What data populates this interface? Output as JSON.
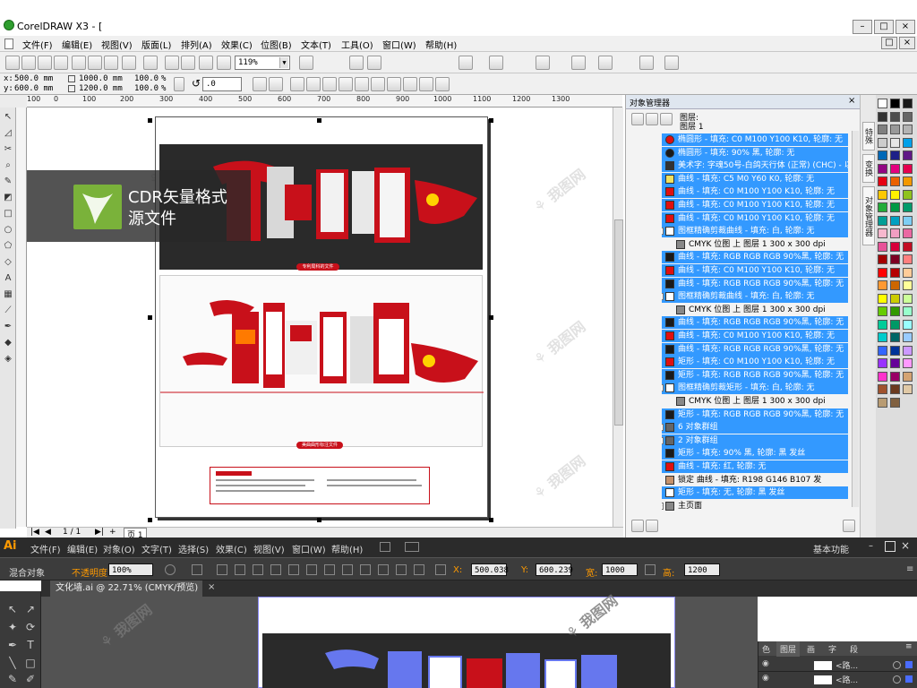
{
  "corel": {
    "title": "CorelDRAW X3 - [",
    "menu": [
      "文件(F)",
      "编辑(E)",
      "视图(V)",
      "版面(L)",
      "排列(A)",
      "效果(C)",
      "位图(B)",
      "文本(T)",
      "工具(O)",
      "窗口(W)",
      "帮助(H)"
    ],
    "zoom": "119%",
    "x_label": "x:",
    "x_value": "500.0 mm",
    "y_label": "y:",
    "y_value": "600.0 mm",
    "w_value": "1000.0 mm",
    "h_value": "1200.0 mm",
    "scale_x": "100.0",
    "scale_y": "100.0",
    "pct": "%",
    "angle": ".0",
    "ruler_h": [
      "100",
      "0",
      "100",
      "200",
      "300",
      "400",
      "500",
      "600",
      "700",
      "800",
      "900",
      "1000",
      "1100",
      "1200",
      "1300"
    ],
    "page_nav": "1 / 1",
    "page_tab": "页 1",
    "page_labels": {
      "top": "专利局科的文件",
      "bottom": "美曲曲形标注文件"
    }
  },
  "overlay": {
    "line1": "CDR矢量格式",
    "line2": "源文件"
  },
  "object_manager": {
    "title": "对象管理器",
    "layer_header": "图层:",
    "layer_name": "图层 1",
    "rows": [
      {
        "text": "椭圆形 - 填充: C0 M100 Y100 K10, 轮廓: 无",
        "selected": true,
        "icon": "red-ellipse-icon",
        "color": "#e01010"
      },
      {
        "text": "椭圆形 - 填充: 90% 黑, 轮廓: 无",
        "selected": true,
        "icon": "black-ellipse-icon",
        "color": "#1a1a1a"
      },
      {
        "text": "美术字: 字魂50号-白鸽天行体 (正常) (CHC) - 以",
        "selected": true,
        "icon": "text-a-icon",
        "color": "#333333"
      },
      {
        "text": "曲线 - 填充: C5 M0 Y60 K0, 轮廓: 无",
        "selected": true,
        "icon": "curve-icon",
        "color": "#f0e060"
      },
      {
        "text": "曲线 - 填充: C0 M100 Y100 K10, 轮廓: 无",
        "selected": true,
        "icon": "curve-icon",
        "color": "#e01010"
      },
      {
        "text": "曲线 - 填充: C0 M100 Y100 K10, 轮廓: 无",
        "selected": true,
        "icon": "curve-icon",
        "color": "#e01010"
      },
      {
        "text": "曲线 - 填充: C0 M100 Y100 K10, 轮廓: 无",
        "selected": true,
        "icon": "curve-icon",
        "color": "#e01010"
      },
      {
        "text": "图框精确剪裁曲线 - 填充: 白, 轮廓: 无",
        "selected": true,
        "icon": "powerclip-icon",
        "color": "#ffffff",
        "tree": "-"
      },
      {
        "text": "CMYK 位图 上 图层 1 300 x 300 dpi",
        "selected": false,
        "icon": "bitmap-icon",
        "color": "#888888",
        "indent": true
      },
      {
        "text": "曲线 - 填充: RGB RGB RGB 90%黑, 轮廓: 无",
        "selected": true,
        "icon": "curve-icon",
        "color": "#1a1a1a"
      },
      {
        "text": "曲线 - 填充: C0 M100 Y100 K10, 轮廓: 无",
        "selected": true,
        "icon": "curve-icon",
        "color": "#e01010"
      },
      {
        "text": "曲线 - 填充: RGB RGB RGB 90%黑, 轮廓: 无",
        "selected": true,
        "icon": "curve-icon",
        "color": "#1a1a1a"
      },
      {
        "text": "图框精确剪裁曲线 - 填充: 白, 轮廓: 无",
        "selected": true,
        "icon": "powerclip-icon",
        "color": "#ffffff",
        "tree": "-"
      },
      {
        "text": "CMYK 位图 上 图层 1 300 x 300 dpi",
        "selected": false,
        "icon": "bitmap-icon",
        "color": "#888888",
        "indent": true
      },
      {
        "text": "曲线 - 填充: RGB RGB RGB 90%黑, 轮廓: 无",
        "selected": true,
        "icon": "curve-icon",
        "color": "#1a1a1a"
      },
      {
        "text": "曲线 - 填充: C0 M100 Y100 K10, 轮廓: 无",
        "selected": true,
        "icon": "curve-icon",
        "color": "#e01010"
      },
      {
        "text": "曲线 - 填充: RGB RGB RGB 90%黑, 轮廓: 无",
        "selected": true,
        "icon": "curve-icon",
        "color": "#1a1a1a"
      },
      {
        "text": "矩形 - 填充: C0 M100 Y100 K10, 轮廓: 无",
        "selected": true,
        "icon": "rect-icon",
        "color": "#e01010"
      },
      {
        "text": "矩形 - 填充: RGB RGB RGB 90%黑, 轮廓: 无",
        "selected": true,
        "icon": "rect-icon",
        "color": "#1a1a1a"
      },
      {
        "text": "图框精确剪裁矩形 - 填充: 白, 轮廓: 无",
        "selected": true,
        "icon": "rect-icon",
        "color": "#ffffff",
        "tree": "-"
      },
      {
        "text": "CMYK 位图 上 图层 1 300 x 300 dpi",
        "selected": false,
        "icon": "bitmap-icon",
        "color": "#888888",
        "indent": true
      },
      {
        "text": "矩形 - 填充: RGB RGB RGB 90%黑, 轮廓: 无",
        "selected": true,
        "icon": "rect-icon",
        "color": "#1a1a1a"
      },
      {
        "text": "6 对象群组",
        "selected": true,
        "icon": "group-icon",
        "color": "#666666",
        "tree": "+"
      },
      {
        "text": "2 对象群组",
        "selected": true,
        "icon": "group-icon",
        "color": "#666666",
        "tree": "+"
      },
      {
        "text": "矩形 - 填充: 90% 黑, 轮廓: 黑 发丝",
        "selected": true,
        "icon": "rect-icon",
        "color": "#1a1a1a"
      },
      {
        "text": "曲线 - 填充: 红, 轮廓: 无",
        "selected": true,
        "icon": "curve-icon",
        "color": "#e01010"
      },
      {
        "text": "锁定 曲线 - 填充: R198 G146 B107 发",
        "selected": false,
        "icon": "lock-icon",
        "color": "#c6926b"
      },
      {
        "text": "矩形 - 填充: 无, 轮廓: 黑 发丝",
        "selected": true,
        "icon": "rect-icon",
        "color": "#ffffff"
      },
      {
        "text": "主页面",
        "selected": false,
        "icon": "page-icon",
        "color": "#888888",
        "tree": "+"
      }
    ]
  },
  "side_tabs": [
    "特殊",
    "变换",
    "对象管理器"
  ],
  "palette": [
    "#ffffff",
    "#000000",
    "#1a1a1a",
    "#333333",
    "#4d4d4d",
    "#666666",
    "#808080",
    "#999999",
    "#b3b3b3",
    "#cccccc",
    "#e6e6e6",
    "#00a0e9",
    "#0068b7",
    "#1d2088",
    "#601986",
    "#920783",
    "#e4007f",
    "#e5004f",
    "#e60012",
    "#eb6100",
    "#f39800",
    "#fcc800",
    "#fff100",
    "#8fc31f",
    "#22ac38",
    "#009944",
    "#009b6b",
    "#009e96",
    "#00a0c1",
    "#7ecef4",
    "#f7b8ce",
    "#f19ec2",
    "#ea68a2",
    "#e85298",
    "#d7003a",
    "#c30d23",
    "#a40000",
    "#7d0022",
    "#ff7f7f",
    "#ff0000",
    "#b50000",
    "#ffcc99",
    "#ff9933",
    "#cc6600",
    "#ffff99",
    "#ffff00",
    "#cccc00",
    "#ccff99",
    "#66cc00",
    "#339900",
    "#99ffcc",
    "#00cc99",
    "#009966",
    "#99ffff",
    "#00cccc",
    "#006666",
    "#99ccff",
    "#3366ff",
    "#003399",
    "#cc99ff",
    "#9933ff",
    "#660099",
    "#ff99ff",
    "#ff33cc",
    "#990066",
    "#d4a373",
    "#a0522d",
    "#6b3a1f",
    "#e0c9a6",
    "#b89b72",
    "#806040"
  ],
  "illustrator": {
    "logo": "Ai",
    "menu": [
      "文件(F)",
      "编辑(E)",
      "对象(O)",
      "文字(T)",
      "选择(S)",
      "效果(C)",
      "视图(V)",
      "窗口(W)",
      "帮助(H)"
    ],
    "workspace": "基本功能",
    "ctrl_label": "混合对象",
    "opacity_label": "不透明度:",
    "opacity_value": "100%",
    "x_label": "X:",
    "x_value": "500.038",
    "y_label": "Y:",
    "y_value": "600.239",
    "w_label": "宽:",
    "w_value": "1000 mm",
    "h_label": "高:",
    "h_value": "1200 mm",
    "tab_label": "文化墙.ai @ 22.71% (CMYK/预览)",
    "layers_tabs": [
      "色",
      "图层",
      "画",
      "字",
      "段"
    ],
    "layer_rows": [
      "<路...",
      "<路..."
    ]
  }
}
